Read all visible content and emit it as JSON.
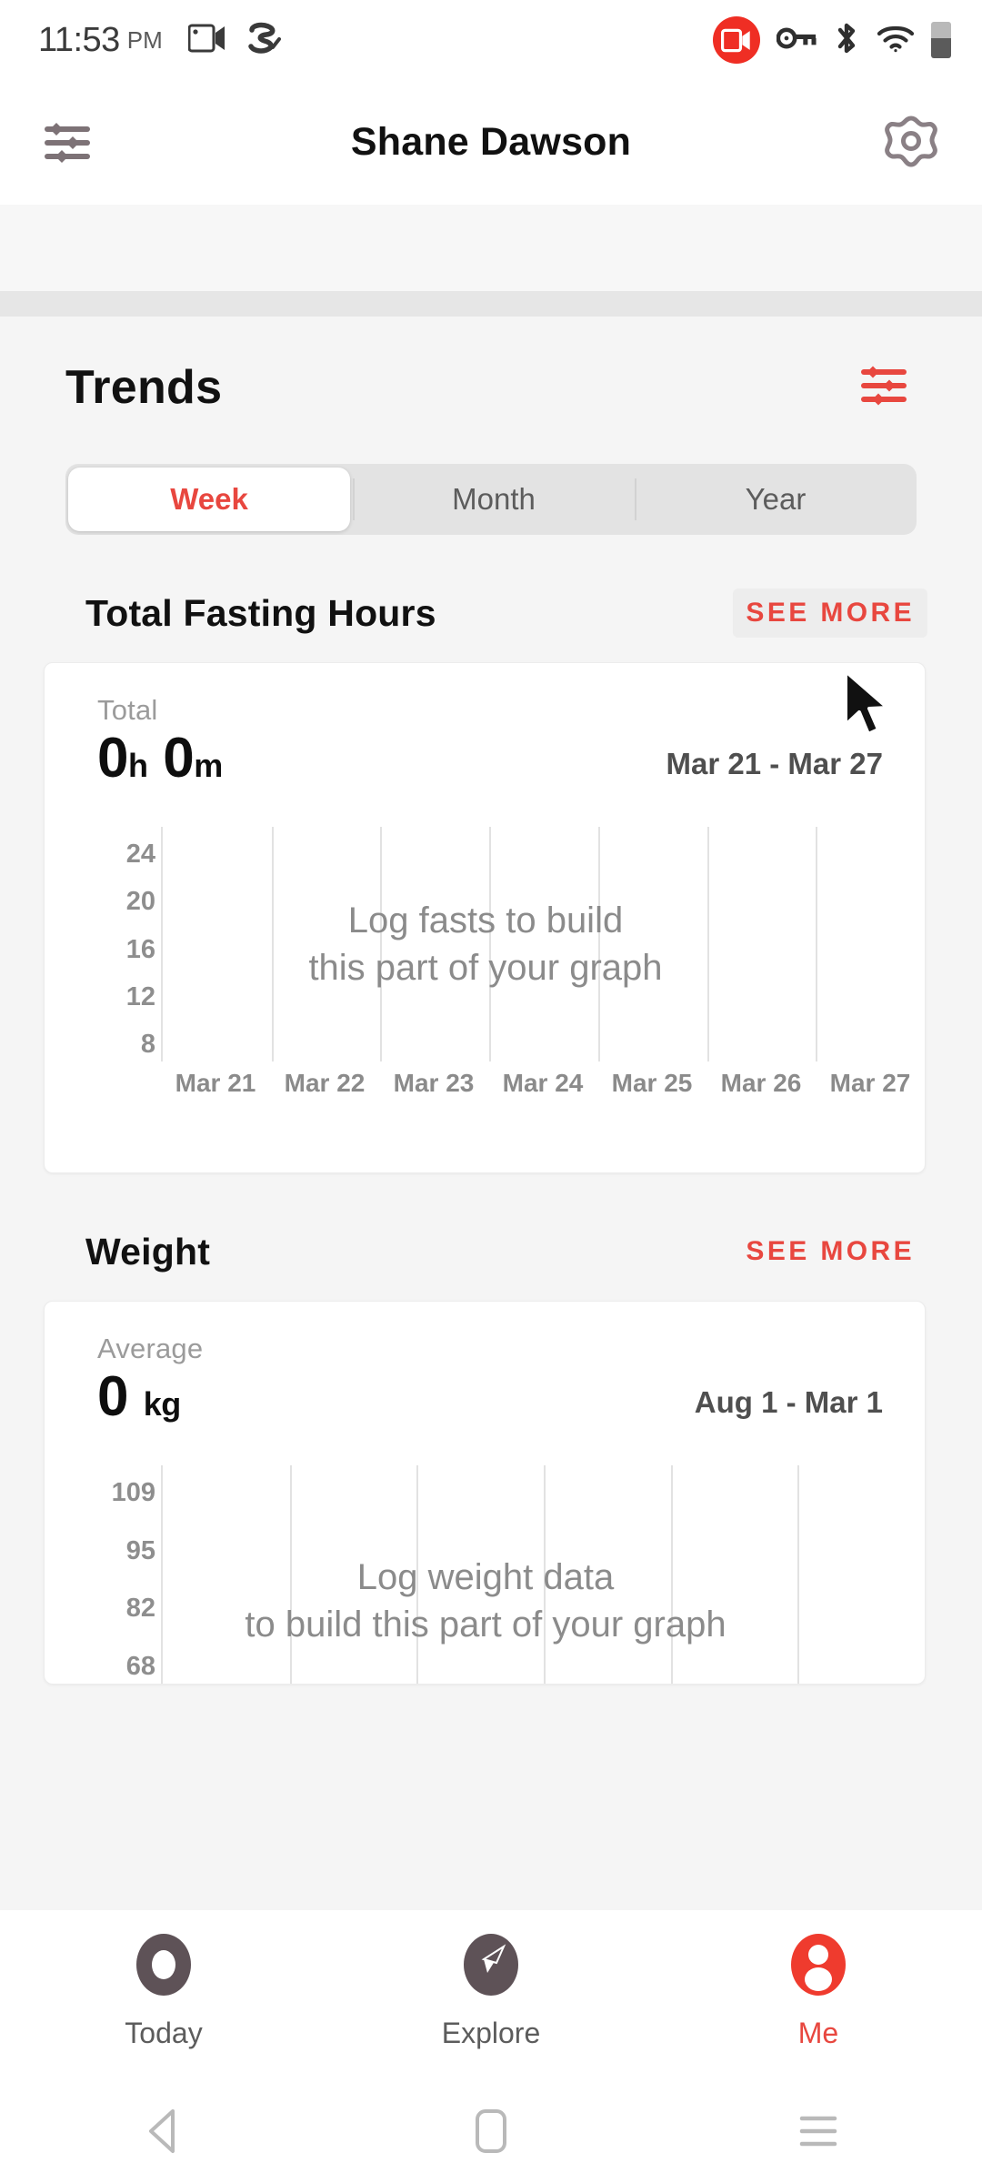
{
  "status_bar": {
    "time": "11:53",
    "ampm": "PM",
    "left_icons": [
      "screencast-icon",
      "sleep-tracker-icon"
    ],
    "right_icons": [
      "screen-record-icon",
      "vpn-key-icon",
      "bluetooth-icon",
      "wifi-icon",
      "battery-icon"
    ]
  },
  "app_bar": {
    "title": "Shane Dawson",
    "left_icon": "sliders-icon",
    "right_icon": "gear-icon"
  },
  "trends": {
    "title": "Trends",
    "filter_icon": "sliders-icon",
    "range_tabs": [
      {
        "label": "Week",
        "active": true
      },
      {
        "label": "Month",
        "active": false
      },
      {
        "label": "Year",
        "active": false
      }
    ]
  },
  "fasting": {
    "section_title": "Total Fasting Hours",
    "see_more_label": "SEE MORE",
    "kicker": "Total",
    "value_hours": "0",
    "unit_hours": "h",
    "value_minutes": "0",
    "unit_minutes": "m",
    "date_range": "Mar 21 - Mar 27",
    "empty_line_1": "Log fasts to build",
    "empty_line_2": "this part of your graph"
  },
  "weight": {
    "section_title": "Weight",
    "see_more_label": "SEE MORE",
    "kicker": "Average",
    "value": "0",
    "unit": "kg",
    "date_range": "Aug 1 - Mar 1",
    "empty_line_1": "Log weight data",
    "empty_line_2": "to build this part of your graph"
  },
  "bottom_nav": [
    {
      "label": "Today",
      "icon": "record-circle-icon",
      "active": false
    },
    {
      "label": "Explore",
      "icon": "compass-icon",
      "active": false
    },
    {
      "label": "Me",
      "icon": "person-icon",
      "active": true
    }
  ],
  "system_nav": [
    "back-icon",
    "home-icon",
    "recents-icon"
  ],
  "colors": {
    "accent": "#e8473f",
    "text_primary": "#111111",
    "text_muted": "#8b8b8b",
    "page_bg": "#f5f5f5",
    "card_bg": "#ffffff",
    "gridline": "#e2e2e2"
  },
  "chart_data": [
    {
      "type": "bar",
      "title": "Total Fasting Hours",
      "categories": [
        "Mar 21",
        "Mar 22",
        "Mar 23",
        "Mar 24",
        "Mar 25",
        "Mar 26",
        "Mar 27"
      ],
      "values": [
        0,
        0,
        0,
        0,
        0,
        0,
        0
      ],
      "ytick_labels": [
        "24",
        "20",
        "16",
        "12",
        "8"
      ],
      "ylim": [
        8,
        24
      ],
      "ylabel": "",
      "xlabel": "",
      "grid": "vertical",
      "legend": "none",
      "annotation": "Log fasts to build this part of your graph"
    },
    {
      "type": "line",
      "title": "Weight",
      "categories": [],
      "values": [],
      "ytick_labels": [
        "109",
        "95",
        "82",
        "68"
      ],
      "ylim": [
        68,
        109
      ],
      "ylabel": "kg",
      "xlabel": "",
      "grid": "vertical",
      "legend": "none",
      "annotation": "Log weight data to build this part of your graph"
    }
  ]
}
